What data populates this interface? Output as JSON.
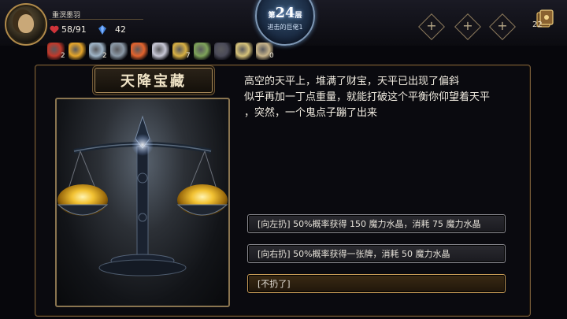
{
  "player": {
    "name": "重溟墨羽",
    "hp": "58/91",
    "mana": "42"
  },
  "floor": {
    "number": "24",
    "prefix": "第",
    "suffix": "层",
    "subtitle": "进击的巨佬1"
  },
  "bag": {
    "count": "22"
  },
  "items": [
    {
      "icon": "dagger-icon",
      "count": "2",
      "color": "#c0392b"
    },
    {
      "icon": "fried-shrimp-icon",
      "count": "",
      "color": "#e5a52a"
    },
    {
      "icon": "potion-bottle-icon",
      "count": "2",
      "color": "#9fb4c7"
    },
    {
      "icon": "hammer-icon",
      "count": "",
      "color": "#8c9aa8"
    },
    {
      "icon": "orange-flask-icon",
      "count": "",
      "color": "#e3632d"
    },
    {
      "icon": "harp-icon",
      "count": "",
      "color": "#c8c8d6"
    },
    {
      "icon": "golden-bow-icon",
      "count": "7",
      "color": "#d8b043"
    },
    {
      "icon": "scroll-bottle-icon",
      "count": "",
      "color": "#7ea35a"
    },
    {
      "icon": "dark-blade-icon",
      "count": "",
      "color": "#4a4a58"
    },
    {
      "icon": "shield-icon",
      "count": "",
      "color": "#d6c27a"
    },
    {
      "icon": "map-icon",
      "count": "0",
      "color": "#c8b48a"
    }
  ],
  "event": {
    "title": "天降宝藏",
    "text_lines": [
      "高空的天平上，堆满了财宝，天平已出现了偏斜",
      "似乎再加一丁点重量，就能打破这个平衡你仰望着天平",
      "，突然，一个鬼点子蹦了出来"
    ]
  },
  "choices": [
    {
      "label": "[向左扔] 50%概率获得 150 魔力水晶，消耗 75 魔力水晶"
    },
    {
      "label": "[向右扔] 50%概率获得一张牌，消耗 50 魔力水晶"
    },
    {
      "label": "[不扔了]"
    }
  ],
  "colors": {
    "accent_gold": "#b08a4a",
    "panel_border": "#7a5e3a",
    "hp_red": "#d0343a",
    "mana_blue": "#3f7fd6"
  }
}
